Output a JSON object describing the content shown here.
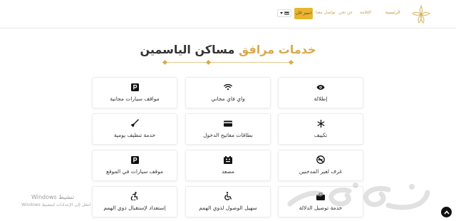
{
  "header": {
    "nav": {
      "home": "الرئيسية",
      "accommodation": "الإقامة",
      "about": "عن نحن",
      "contact": "تواصل معنا"
    },
    "book_label": "احجز الآن"
  },
  "section": {
    "title_dark": "مساكن الياسمين",
    "title_gold": "خدمات مرافق"
  },
  "services": [
    {
      "label": "إطلالة",
      "icon": "eye-icon"
    },
    {
      "label": "واي فاي مجاني",
      "icon": "wifi-icon"
    },
    {
      "label": "مواقف سيارات مجانية",
      "icon": "parking-icon"
    },
    {
      "label": "تكييف",
      "icon": "snowflake-icon"
    },
    {
      "label": "بطاقات مفاتيح الدخول",
      "icon": "keycard-icon"
    },
    {
      "label": "خدمة تنظيف يومية",
      "icon": "broom-icon"
    },
    {
      "label": "غرف لغير المدخنين",
      "icon": "no-smoking-icon"
    },
    {
      "label": "مصعد",
      "icon": "elevator-icon"
    },
    {
      "label": "موقف سيارات في الموقع",
      "icon": "parking-icon"
    },
    {
      "label": "خدمة توصيل الدلالة",
      "icon": "luggage-icon"
    },
    {
      "label": "سهيل الوصول لذوي الهمم",
      "icon": "wheelchair-icon"
    },
    {
      "label": "إستعداد لإستقبال ذوي الهمم",
      "icon": "accessible-icon"
    }
  ],
  "watermark": {
    "line1": "تنشيط Windows",
    "line2": "انتقل إلى الإعدادات لتنشيط Windows"
  },
  "colors": {
    "gold": "#d8a94e",
    "button": "#e8b52f"
  }
}
